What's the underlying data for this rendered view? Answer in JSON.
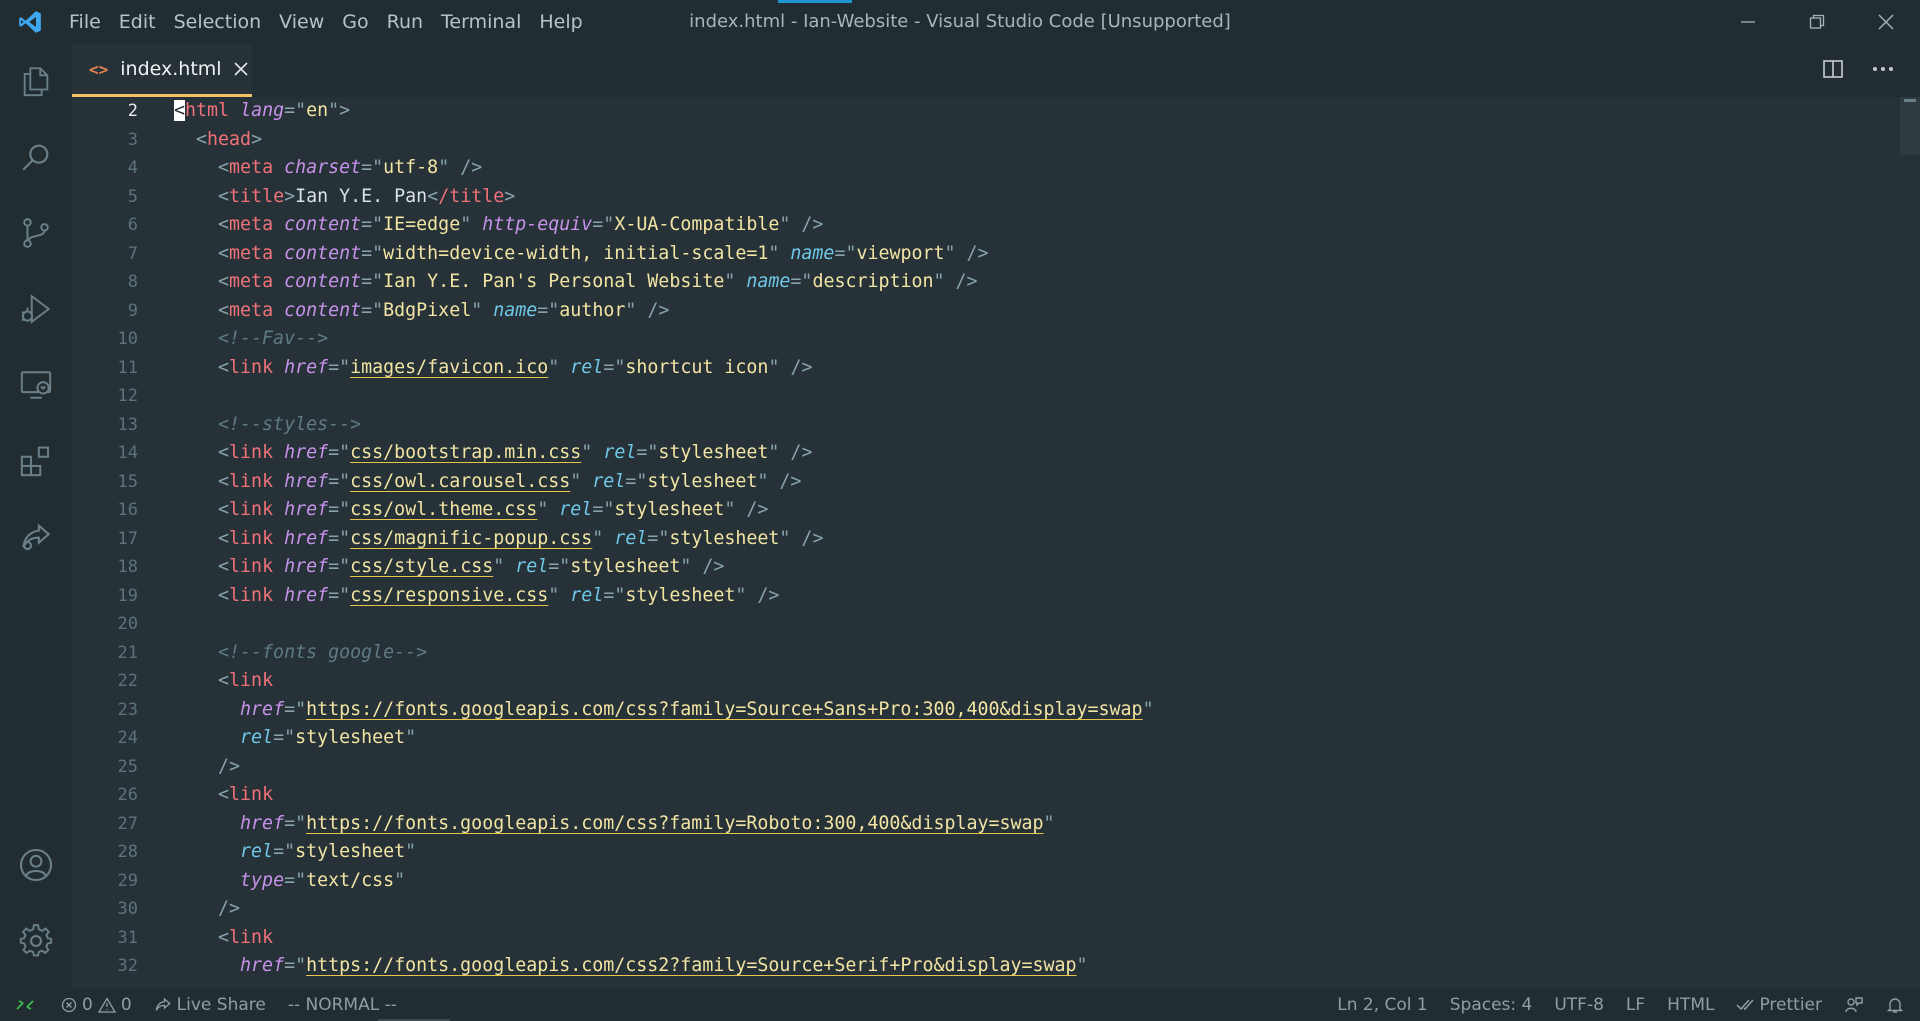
{
  "window": {
    "title": "index.html - Ian-Website - Visual Studio Code [Unsupported]",
    "menu": [
      "File",
      "Edit",
      "Selection",
      "View",
      "Go",
      "Run",
      "Terminal",
      "Help"
    ]
  },
  "tab": {
    "label": "index.html",
    "icon": "<>"
  },
  "editor": {
    "line_numbers": [
      "2",
      "3",
      "4",
      "5",
      "6",
      "7",
      "8",
      "9",
      "10",
      "11",
      "12",
      "13",
      "14",
      "15",
      "16",
      "17",
      "18",
      "19",
      "20",
      "21",
      "22",
      "23",
      "24",
      "25",
      "26",
      "27",
      "28",
      "29",
      "30",
      "31",
      "32"
    ],
    "active_line": "2",
    "code": {
      "l2": {
        "tag": "html",
        "attr": "lang",
        "val": "en"
      },
      "l3": {
        "tag": "head"
      },
      "l4": {
        "tag": "meta",
        "attr": "charset",
        "val": "utf-8"
      },
      "l5": {
        "tag": "title",
        "text": "Ian Y.E. Pan",
        "close": "/title"
      },
      "l6": {
        "tag": "meta",
        "attr1": "content",
        "val1": "IE=edge",
        "attr2": "http-equiv",
        "val2": "X-UA-Compatible"
      },
      "l7": {
        "tag": "meta",
        "attr1": "content",
        "val1": "width=device-width, initial-scale=1",
        "attr2": "name",
        "val2": "viewport"
      },
      "l8": {
        "tag": "meta",
        "attr1": "content",
        "val1": "Ian Y.E. Pan's Personal Website",
        "attr2": "name",
        "val2": "description"
      },
      "l9": {
        "tag": "meta",
        "attr1": "content",
        "val1": "BdgPixel",
        "attr2": "name",
        "val2": "author"
      },
      "l10": {
        "comment": "<!--Fav-->"
      },
      "l11": {
        "tag": "link",
        "attr1": "href",
        "val1": "images/favicon.ico",
        "attr2": "rel",
        "val2": "shortcut icon"
      },
      "l13": {
        "comment": "<!--styles-->"
      },
      "l14": {
        "tag": "link",
        "attr1": "href",
        "val1": "css/bootstrap.min.css",
        "attr2": "rel",
        "val2": "stylesheet"
      },
      "l15": {
        "tag": "link",
        "attr1": "href",
        "val1": "css/owl.carousel.css",
        "attr2": "rel",
        "val2": "stylesheet"
      },
      "l16": {
        "tag": "link",
        "attr1": "href",
        "val1": "css/owl.theme.css",
        "attr2": "rel",
        "val2": "stylesheet"
      },
      "l17": {
        "tag": "link",
        "attr1": "href",
        "val1": "css/magnific-popup.css",
        "attr2": "rel",
        "val2": "stylesheet"
      },
      "l18": {
        "tag": "link",
        "attr1": "href",
        "val1": "css/style.css",
        "attr2": "rel",
        "val2": "stylesheet"
      },
      "l19": {
        "tag": "link",
        "attr1": "href",
        "val1": "css/responsive.css",
        "attr2": "rel",
        "val2": "stylesheet"
      },
      "l21": {
        "comment": "<!--fonts google-->"
      },
      "l22": {
        "tag": "link"
      },
      "l23": {
        "attr": "href",
        "val": "https://fonts.googleapis.com/css?family=Source+Sans+Pro:300,400&display=swap"
      },
      "l24": {
        "attr": "rel",
        "val": "stylesheet"
      },
      "l25": {
        "close": "/>"
      },
      "l26": {
        "tag": "link"
      },
      "l27": {
        "attr": "href",
        "val": "https://fonts.googleapis.com/css?family=Roboto:300,400&display=swap"
      },
      "l28": {
        "attr": "rel",
        "val": "stylesheet"
      },
      "l29": {
        "attr": "type",
        "val": "text/css"
      },
      "l30": {
        "close": "/>"
      },
      "l31": {
        "tag": "link"
      },
      "l32": {
        "attr": "href",
        "val": "https://fonts.googleapis.com/css2?family=Source+Serif+Pro&display=swap"
      }
    }
  },
  "statusbar": {
    "errors": "0",
    "warnings": "0",
    "live_share": "Live Share",
    "vim_mode": "-- NORMAL --",
    "position": "Ln 2, Col 1",
    "spaces": "Spaces: 4",
    "encoding": "UTF-8",
    "eol": "LF",
    "language": "HTML",
    "formatter": "Prettier"
  },
  "colors": {
    "accent": "#1f95d4",
    "tab_underline": "#f3c062",
    "background": "#263238"
  }
}
